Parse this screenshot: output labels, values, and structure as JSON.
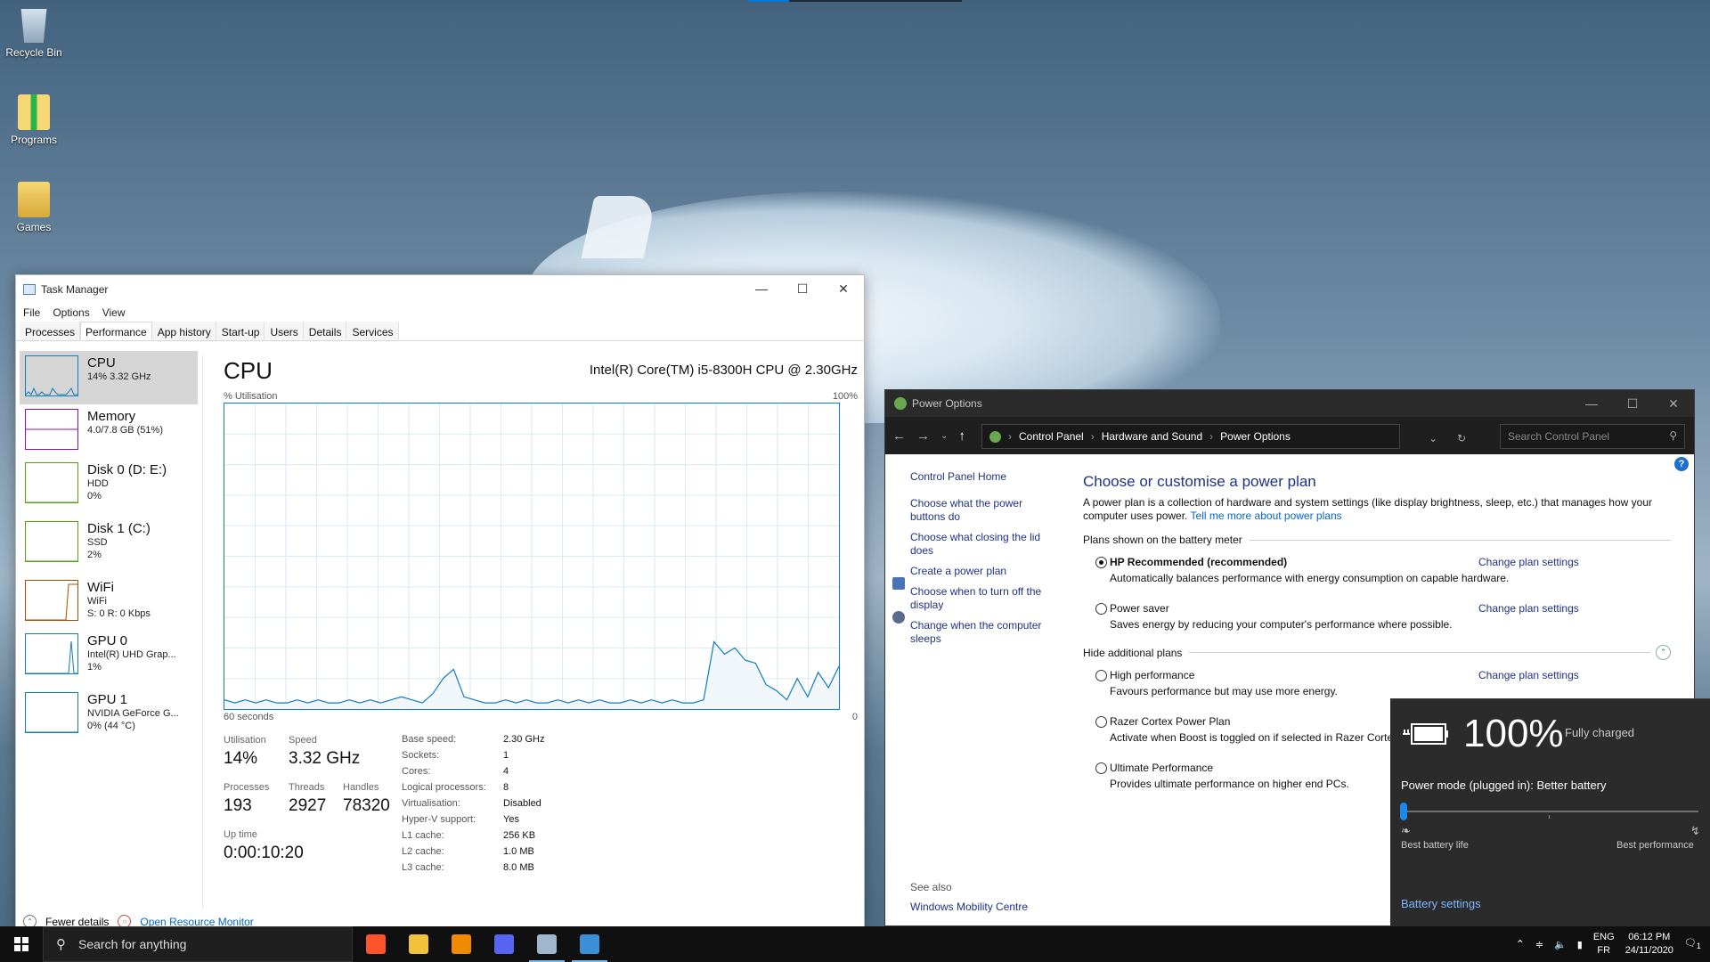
{
  "desktop": {
    "icons": [
      {
        "label": "Recycle Bin",
        "icon": "recycle-bin-icon"
      },
      {
        "label": "Programs",
        "icon": "folder-icon"
      },
      {
        "label": "Games",
        "icon": "folder-icon"
      }
    ]
  },
  "task_manager": {
    "title": "Task Manager",
    "menu": [
      "File",
      "Options",
      "View"
    ],
    "tabs": [
      "Processes",
      "Performance",
      "App history",
      "Start-up",
      "Users",
      "Details",
      "Services"
    ],
    "active_tab": "Performance",
    "sidebar": [
      {
        "name": "CPU",
        "line1": "14% 3.32 GHz",
        "line2": "",
        "color": "#117dbb"
      },
      {
        "name": "Memory",
        "line1": "4.0/7.8 GB (51%)",
        "line2": "",
        "color": "#8b12ae"
      },
      {
        "name": "Disk 0 (D: E:)",
        "line1": "HDD",
        "line2": "0%",
        "color": "#4da60c"
      },
      {
        "name": "Disk 1 (C:)",
        "line1": "SSD",
        "line2": "2%",
        "color": "#4da60c"
      },
      {
        "name": "WiFi",
        "line1": "WiFi",
        "line2": "S: 0 R: 0 Kbps",
        "color": "#a74f01"
      },
      {
        "name": "GPU 0",
        "line1": "Intel(R) UHD Grap...",
        "line2": "1%",
        "color": "#117dbb"
      },
      {
        "name": "GPU 1",
        "line1": "NVIDIA GeForce G...",
        "line2": "0% (44 °C)",
        "color": "#117dbb"
      }
    ],
    "cpu": {
      "heading": "CPU",
      "model": "Intel(R) Core(TM) i5-8300H CPU @ 2.30GHz",
      "graph_label": "% Utilisation",
      "graph_max": "100%",
      "graph_time": "60 seconds",
      "graph_min": "0",
      "utilisation_label": "Utilisation",
      "utilisation": "14%",
      "speed_label": "Speed",
      "speed": "3.32 GHz",
      "processes_label": "Processes",
      "processes": "193",
      "threads_label": "Threads",
      "threads": "2927",
      "handles_label": "Handles",
      "handles": "78320",
      "uptime_label": "Up time",
      "uptime": "0:00:10:20",
      "specs": [
        {
          "k": "Base speed:",
          "v": "2.30 GHz"
        },
        {
          "k": "Sockets:",
          "v": "1"
        },
        {
          "k": "Cores:",
          "v": "4"
        },
        {
          "k": "Logical processors:",
          "v": "8"
        },
        {
          "k": "Virtualisation:",
          "v": "Disabled"
        },
        {
          "k": "Hyper-V support:",
          "v": "Yes"
        },
        {
          "k": "L1 cache:",
          "v": "256 KB"
        },
        {
          "k": "L2 cache:",
          "v": "1.0 MB"
        },
        {
          "k": "L3 cache:",
          "v": "8.0 MB"
        }
      ],
      "history": [
        3,
        2,
        3,
        2,
        3,
        2,
        2,
        3,
        2,
        3,
        2,
        2,
        3,
        2,
        3,
        2,
        3,
        4,
        3,
        2,
        5,
        10,
        13,
        4,
        3,
        2,
        2,
        3,
        2,
        3,
        2,
        2,
        3,
        2,
        3,
        2,
        3,
        2,
        2,
        3,
        2,
        3,
        2,
        3,
        2,
        2,
        3,
        22,
        18,
        20,
        16,
        15,
        8,
        6,
        3,
        10,
        4,
        12,
        7,
        14
      ]
    },
    "footer": {
      "fewer": "Fewer details",
      "monitor": "Open Resource Monitor"
    }
  },
  "power_options": {
    "title": "Power Options",
    "breadcrumb": [
      "Control Panel",
      "Hardware and Sound",
      "Power Options"
    ],
    "search_placeholder": "Search Control Panel",
    "left_links": [
      "Control Panel Home",
      "Choose what the power buttons do",
      "Choose what closing the lid does",
      "Create a power plan",
      "Choose when to turn off the display",
      "Change when the computer sleeps"
    ],
    "see_also": "See also",
    "see_also_links": [
      "Windows Mobility Centre"
    ],
    "heading": "Choose or customise a power plan",
    "description": "A power plan is a collection of hardware and system settings (like display brightness, sleep, etc.) that manages how your computer uses power.",
    "learn_more": "Tell me more about power plans",
    "group_battery": "Plans shown on the battery meter",
    "group_hidden": "Hide additional plans",
    "change_settings": "Change plan settings",
    "plans_shown": [
      {
        "name": "HP Recommended (recommended)",
        "desc": "Automatically balances performance with energy consumption on capable hardware.",
        "selected": true
      },
      {
        "name": "Power saver",
        "desc": "Saves energy by reducing your computer's performance where possible.",
        "selected": false
      }
    ],
    "plans_hidden": [
      {
        "name": "High performance",
        "desc": "Favours performance but may use more energy.",
        "has_settings": true
      },
      {
        "name": "Razer Cortex Power Plan",
        "desc": "Activate when Boost is toggled on if selected in Razer Corte",
        "has_settings": false
      },
      {
        "name": "Ultimate Performance",
        "desc": "Provides ultimate performance on higher end PCs.",
        "has_settings": false
      }
    ]
  },
  "battery_flyout": {
    "percent": "100%",
    "status": "Fully charged",
    "mode": "Power mode (plugged in): Better battery",
    "slider_value": 0,
    "left_label": "Best battery life",
    "right_label": "Best performance",
    "link": "Battery settings"
  },
  "taskbar": {
    "search_placeholder": "Search for anything",
    "apps": [
      {
        "name": "brave",
        "color": "#fb542b",
        "active": false
      },
      {
        "name": "file-explorer",
        "color": "#f3c13a",
        "active": false
      },
      {
        "name": "vlc",
        "color": "#f08a00",
        "active": false
      },
      {
        "name": "discord",
        "color": "#5865f2",
        "active": false
      },
      {
        "name": "task-manager",
        "color": "#9fb6cc",
        "active": true
      },
      {
        "name": "control-panel",
        "color": "#3a8fd6",
        "active": true
      }
    ],
    "lang_1": "ENG",
    "lang_2": "FR",
    "time": "06:12 PM",
    "date": "24/11/2020",
    "notifications": "1"
  }
}
